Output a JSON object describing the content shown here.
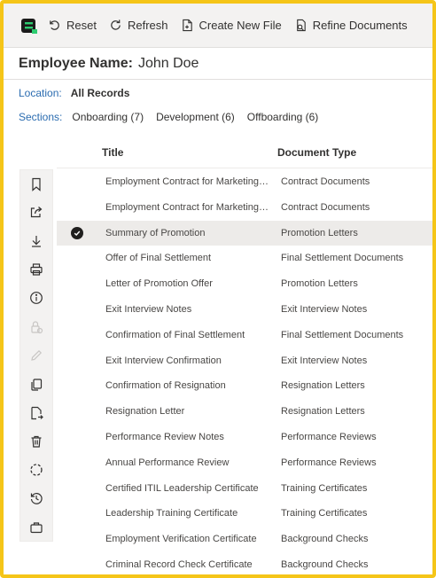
{
  "toolbar": {
    "reset_label": "Reset",
    "refresh_label": "Refresh",
    "create_label": "Create New File",
    "refine_label": "Refine Documents"
  },
  "header": {
    "label": "Employee Name:",
    "value": "John Doe"
  },
  "location": {
    "label": "Location:",
    "value": "All Records"
  },
  "sections": {
    "label": "Sections:",
    "items": [
      "Onboarding (7)",
      "Development (6)",
      "Offboarding (6)"
    ]
  },
  "table": {
    "columns": [
      "Title",
      "Document Type"
    ],
    "selected_index": 2,
    "rows": [
      {
        "title": "Employment Contract for Marketing…",
        "type": "Contract Documents"
      },
      {
        "title": "Employment Contract for Marketing…",
        "type": "Contract Documents"
      },
      {
        "title": "Summary of Promotion",
        "type": "Promotion Letters"
      },
      {
        "title": "Offer of Final Settlement",
        "type": "Final Settlement Documents"
      },
      {
        "title": "Letter of Promotion Offer",
        "type": "Promotion Letters"
      },
      {
        "title": "Exit Interview Notes",
        "type": "Exit Interview Notes"
      },
      {
        "title": "Confirmation of Final Settlement",
        "type": "Final Settlement Documents"
      },
      {
        "title": "Exit Interview Confirmation",
        "type": "Exit Interview Notes"
      },
      {
        "title": "Confirmation of Resignation",
        "type": "Resignation Letters"
      },
      {
        "title": "Resignation Letter",
        "type": "Resignation Letters"
      },
      {
        "title": "Performance Review Notes",
        "type": "Performance Reviews"
      },
      {
        "title": "Annual Performance Review",
        "type": "Performance Reviews"
      },
      {
        "title": "Certified ITIL Leadership Certificate",
        "type": "Training Certificates"
      },
      {
        "title": "Leadership Training Certificate",
        "type": "Training Certificates"
      },
      {
        "title": "Employment Verification Certificate",
        "type": "Background Checks"
      },
      {
        "title": "Criminal Record Check Certificate",
        "type": "Background Checks"
      }
    ]
  },
  "side_icons": [
    "bookmark-icon",
    "share-icon",
    "download-icon",
    "print-icon",
    "info-icon",
    "lock-icon",
    "edit-icon",
    "copy-icon",
    "move-file-icon",
    "delete-icon",
    "sync-icon",
    "history-icon",
    "briefcase-icon"
  ],
  "colors": {
    "accent_border": "#f5c518",
    "label_blue": "#2b6cb0",
    "logo_green": "#2ecc71"
  }
}
